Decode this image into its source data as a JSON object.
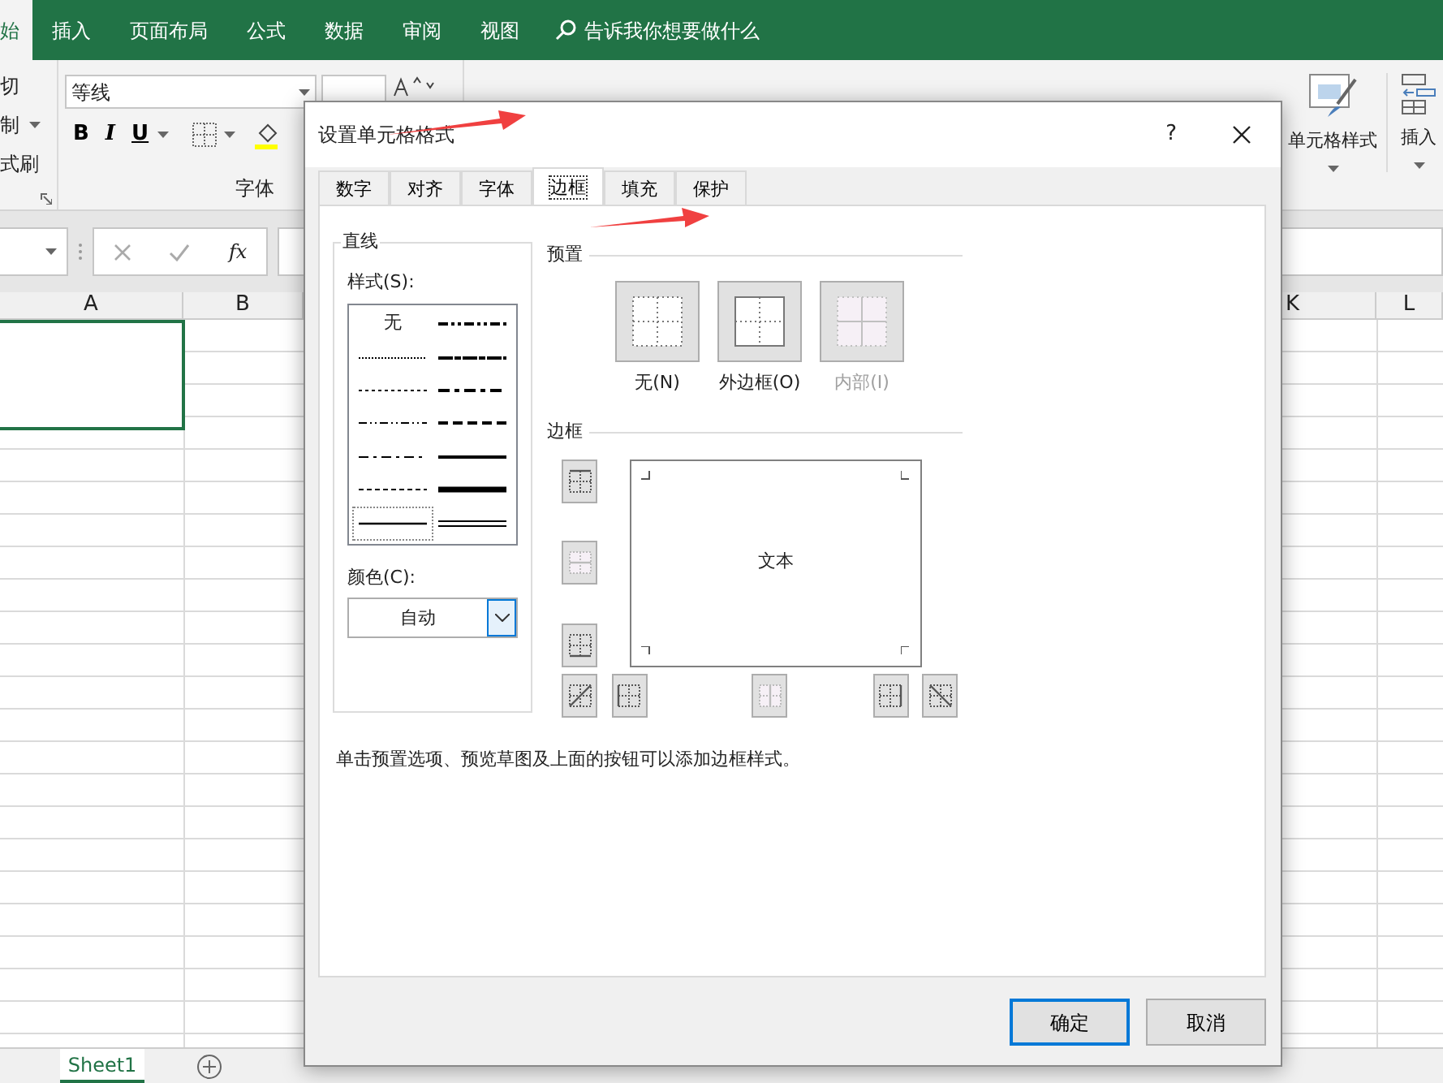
{
  "ribbon": {
    "tabs": [
      {
        "label": "始",
        "selected": true
      },
      {
        "label": "插入",
        "selected": false
      },
      {
        "label": "页面布局",
        "selected": false
      },
      {
        "label": "公式",
        "selected": false
      },
      {
        "label": "数据",
        "selected": false
      },
      {
        "label": "审阅",
        "selected": false
      },
      {
        "label": "视图",
        "selected": false
      }
    ],
    "search": {
      "placeholder": "告诉我你想要做什么"
    },
    "clipboard": [
      {
        "label": "切",
        "caret": false
      },
      {
        "label": "制",
        "caret": true
      },
      {
        "label": "式刷",
        "caret": false
      }
    ],
    "font": {
      "name": "等线",
      "format_buttons": [
        "B",
        "I",
        "U"
      ],
      "group_label": "字体"
    },
    "cell_styles": "单元格样式",
    "insert": "插入"
  },
  "formula_bar": {
    "function_label": "fx"
  },
  "columns": [
    {
      "label": "A"
    },
    {
      "label": "B"
    },
    {
      "label": "K"
    },
    {
      "label": "L"
    }
  ],
  "sheet_tabs": [
    {
      "label": "Sheet1",
      "selected": true
    }
  ],
  "dialog": {
    "title": "设置单元格格式",
    "help": "?",
    "tabs": [
      {
        "label": "数字",
        "selected": false
      },
      {
        "label": "对齐",
        "selected": false
      },
      {
        "label": "字体",
        "selected": false
      },
      {
        "label": "边框",
        "selected": true
      },
      {
        "label": "填充",
        "selected": false
      },
      {
        "label": "保护",
        "selected": false
      }
    ],
    "line": {
      "title": "直线",
      "style_label": "样式(S):",
      "styles": [
        {
          "kind": "none",
          "label": "无",
          "selected": false
        },
        {
          "kind": "hair",
          "selected": false
        },
        {
          "kind": "dotted",
          "selected": false
        },
        {
          "kind": "dashdotdot",
          "selected": false
        },
        {
          "kind": "dashdot",
          "selected": false
        },
        {
          "kind": "dashed",
          "selected": false
        },
        {
          "kind": "thin",
          "selected": true
        },
        {
          "kind": "medium_dashdotdot",
          "selected": false
        },
        {
          "kind": "slant_dashdot",
          "selected": false
        },
        {
          "kind": "medium_dashdot",
          "selected": false
        },
        {
          "kind": "medium_dashed",
          "selected": false
        },
        {
          "kind": "medium",
          "selected": false
        },
        {
          "kind": "thick",
          "selected": false
        },
        {
          "kind": "double",
          "selected": false
        }
      ],
      "color_label": "颜色(C):",
      "color_value": "自动"
    },
    "presets": {
      "title": "预置",
      "items": [
        {
          "kind": "none",
          "label": "无(N)",
          "disabled": false
        },
        {
          "kind": "outline",
          "label": "外边框(O)",
          "disabled": false
        },
        {
          "kind": "inside",
          "label": "内部(I)",
          "disabled": true
        }
      ]
    },
    "border": {
      "title": "边框",
      "preview_text": "文本",
      "side_buttons": [
        {
          "kind": "top",
          "disabled": false
        },
        {
          "kind": "middle_h",
          "disabled": true
        },
        {
          "kind": "bottom",
          "disabled": false
        }
      ],
      "bottom_buttons": [
        {
          "kind": "diag_up",
          "disabled": false
        },
        {
          "kind": "left",
          "disabled": false
        },
        {
          "kind": "middle_v",
          "disabled": true
        },
        {
          "kind": "right",
          "disabled": false
        },
        {
          "kind": "diag_down",
          "disabled": false
        }
      ]
    },
    "hint": "单击预置选项、预览草图及上面的按钮可以添加边框样式。",
    "buttons": [
      {
        "label": "确定",
        "default": true
      },
      {
        "label": "取消",
        "default": false
      }
    ]
  }
}
